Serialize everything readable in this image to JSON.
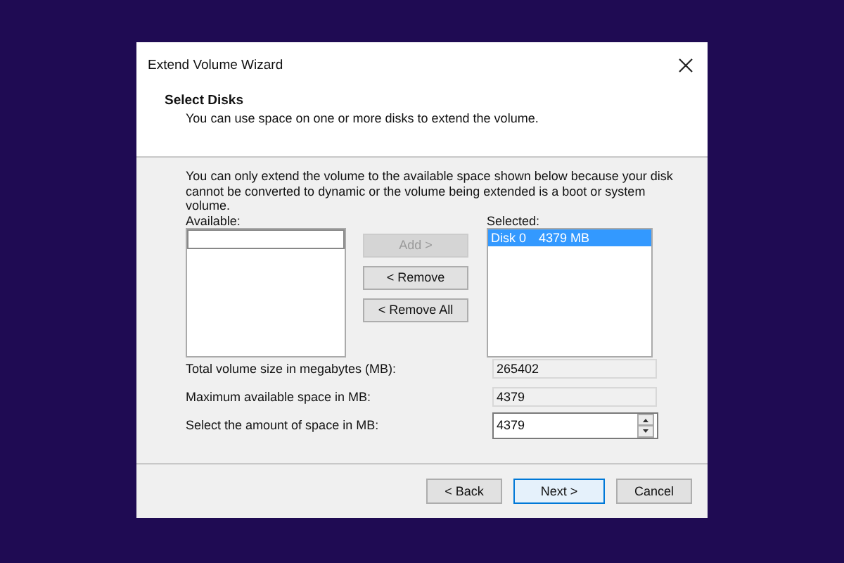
{
  "window": {
    "title": "Extend Volume Wizard"
  },
  "header": {
    "title": "Select Disks",
    "subtitle": "You can use space on one or more disks to extend the volume."
  },
  "note": "You can only extend the volume to the available space shown below because your disk cannot be converted to dynamic or the volume being extended is a boot or system volume.",
  "available": {
    "label": "Available:"
  },
  "transfer_buttons": [
    {
      "label": "Add >",
      "disabled": true
    },
    {
      "label": "< Remove",
      "disabled": false
    },
    {
      "label": "< Remove All",
      "disabled": false
    }
  ],
  "selected_list": {
    "label": "Selected:",
    "items": [
      {
        "disk": "Disk 0",
        "size": "4379 MB",
        "selected": true
      }
    ]
  },
  "fields": [
    {
      "label": "Total volume size in megabytes (MB):",
      "value": "265402",
      "kind": "readonly"
    },
    {
      "label": "Maximum available space in MB:",
      "value": "4379",
      "kind": "readonly"
    },
    {
      "label": "Select the amount of space in MB:",
      "value": "4379",
      "kind": "spin"
    }
  ],
  "footer_buttons": [
    {
      "label": "< Back",
      "default": false
    },
    {
      "label": "Next >",
      "default": true
    },
    {
      "label": "Cancel",
      "default": false
    }
  ]
}
